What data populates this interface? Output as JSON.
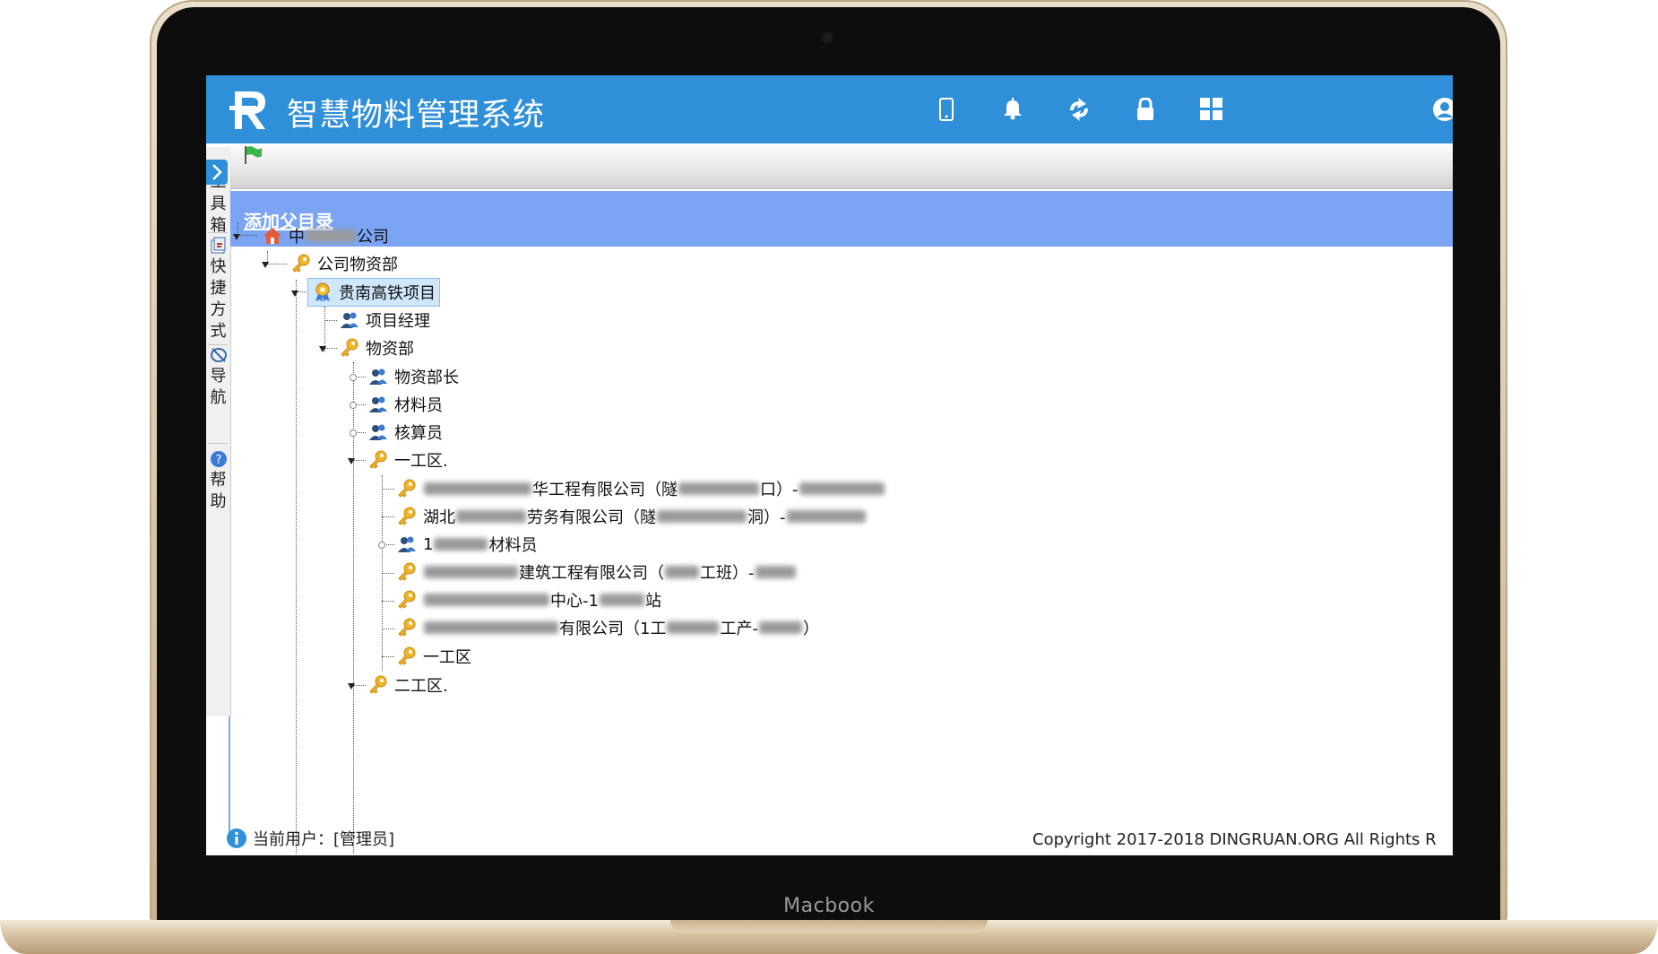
{
  "device": {
    "label": "Macbook"
  },
  "header": {
    "app_title": "智慧物料管理系统",
    "icons": [
      "phone-icon",
      "bell-icon",
      "refresh-icon",
      "lock-icon",
      "grid-icon",
      "user-icon"
    ]
  },
  "sidebar": {
    "sections": [
      {
        "label": "工具箱",
        "icon": "toolbox-icon"
      },
      {
        "label": "快捷方式",
        "icon": "shortcut-icon"
      },
      {
        "label": "导航",
        "icon": "navigation-icon"
      },
      {
        "label": "帮助",
        "icon": "help-icon"
      }
    ]
  },
  "banner": {
    "link_label": "添加父目录"
  },
  "tree": {
    "root": {
      "label_prefix": "中",
      "label_suffix": "公司",
      "icon": "home-icon"
    },
    "dept": {
      "label": "公司物资部",
      "icon": "key-icon"
    },
    "project": {
      "label": "贵南高铁项目",
      "icon": "award-icon"
    },
    "pm": {
      "label": "项目经理",
      "icon": "users-icon"
    },
    "materials": {
      "label": "物资部",
      "icon": "key-icon"
    },
    "roles": [
      {
        "label": "物资部长"
      },
      {
        "label": "材料员"
      },
      {
        "label": "核算员"
      }
    ],
    "zone1": {
      "label": "一工区."
    },
    "zone1_children": [
      {
        "a": "",
        "b": "华工程有限公司（隧",
        "c": "口）-",
        "icon": "key-icon"
      },
      {
        "a": "湖北",
        "b": "劳务有限公司（隧",
        "c": "洞）-",
        "icon": "key-icon"
      },
      {
        "a": "1",
        "b": "材料员",
        "c": "",
        "icon": "users-icon"
      },
      {
        "a": "",
        "b": "建筑工程有限公司（",
        "c": "工班）-",
        "icon": "key-icon"
      },
      {
        "a": "",
        "b": "中心-1",
        "c": "站",
        "icon": "key-icon"
      },
      {
        "a": "",
        "b": "有限公司（1工",
        "c": "工产-",
        "d": "）",
        "icon": "key-icon"
      },
      {
        "a": "一工区",
        "b": "",
        "c": "",
        "icon": "key-icon"
      }
    ],
    "zone2": {
      "label": "二工区."
    }
  },
  "status": {
    "current_user_label": "当前用户：[管理员]"
  },
  "footer": {
    "copyright": "Copyright 2017-2018 DINGRUAN.ORG All Rights R"
  },
  "colors": {
    "header_bg": "#2f8fd8",
    "banner_bg": "#7ba4f4",
    "selected_bg": "#cfe6fb"
  }
}
